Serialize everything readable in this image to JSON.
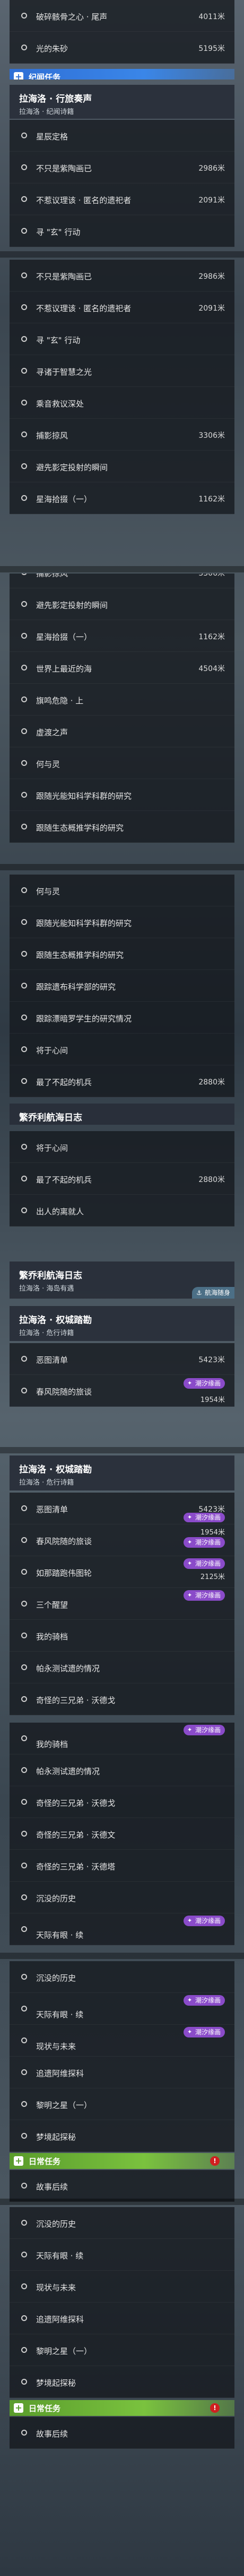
{
  "seg1_rows": [
    {
      "label": "破碎骸骨之心 · 尾声",
      "value": "4011米"
    },
    {
      "label": "光的朱砂",
      "value": "5195米"
    }
  ],
  "cat_mission": "纪闻任务",
  "header1": {
    "title": "拉海洛 · 行旅奏声",
    "subtitle": "拉海洛 · 纪闻诗籍"
  },
  "seg2_rows": [
    {
      "label": "星辰定格",
      "value": ""
    },
    {
      "label": "不只是紫陶画已",
      "value": "2986米"
    },
    {
      "label": "不惹议理该 · 匿名的遗祀者",
      "value": "2091米"
    },
    {
      "label": "寻 \"玄\" 行动",
      "value": ""
    }
  ],
  "seg3_rows": [
    {
      "label": "不只是紫陶画已",
      "value": "2986米"
    },
    {
      "label": "不惹议理该 · 匿名的遗祀者",
      "value": "2091米"
    },
    {
      "label": "寻 \"玄\" 行动",
      "value": ""
    },
    {
      "label": "寻诸于智慧之光",
      "value": ""
    },
    {
      "label": "乘音救议深处",
      "value": ""
    },
    {
      "label": "捕影掠风",
      "value": "3306米"
    },
    {
      "label": "避先影定投射的瞬间",
      "value": ""
    },
    {
      "label": "星海拾掇（一）",
      "value": "1162米"
    }
  ],
  "seg4_rows": [
    {
      "label": "捕影掠风",
      "value": "3306米"
    },
    {
      "label": "避先影定投射的瞬间",
      "value": ""
    },
    {
      "label": "星海拾掇（一）",
      "value": "1162米"
    },
    {
      "label": "世界上最近的海",
      "value": "4504米"
    },
    {
      "label": "旗鸣危隐 · 上",
      "value": ""
    },
    {
      "label": "虚渡之声",
      "value": ""
    },
    {
      "label": "何与灵",
      "value": ""
    },
    {
      "label": "跟随光能知科学科群的研究",
      "value": ""
    },
    {
      "label": "跟随生态概推学科的研究",
      "value": ""
    }
  ],
  "seg5_rows": [
    {
      "label": "何与灵",
      "value": ""
    },
    {
      "label": "跟随光能知科学科群的研究",
      "value": ""
    },
    {
      "label": "跟随生态概推学科的研究",
      "value": ""
    },
    {
      "label": "跟踪遗布科学部的研究",
      "value": ""
    },
    {
      "label": "跟踪漂暗罗学生的研究情况",
      "value": ""
    },
    {
      "label": "将于心间",
      "value": ""
    },
    {
      "label": "最了不起的机兵",
      "value": "2880米"
    }
  ],
  "header_log": "繁乔利航海日志",
  "seg6_rows": [
    {
      "label": "将于心间",
      "value": ""
    },
    {
      "label": "最了不起的机兵",
      "value": "2880米"
    },
    {
      "label": "出人的离就人",
      "value": ""
    }
  ],
  "header2": {
    "title": "繁乔利航海日志",
    "subtitle": "拉海洛 · 海岛有遇",
    "tag": "航海随身"
  },
  "header3": {
    "title": "拉海洛 · 权城踏勘",
    "subtitle": "拉海洛 · 危行诗籍"
  },
  "seg7_rows": [
    {
      "label": "恶图清单",
      "value": "5423米",
      "badge": "",
      "value2": ""
    },
    {
      "label": "春风院随的旅谈",
      "value": "",
      "badge": "潮汐缘画",
      "value2": "1954米"
    }
  ],
  "header4": {
    "title": "拉海洛 · 权城踏勘",
    "subtitle": "拉海洛 · 危行诗籍"
  },
  "seg8_rows": [
    {
      "label": "恶图清单",
      "value": "5423米",
      "badge": "潮汐缘画",
      "value2": ""
    },
    {
      "label": "春风院随的旅谈",
      "value": "",
      "badge": "潮汐缘画",
      "value2": "1954米"
    },
    {
      "label": "如那踏跑伟图轮",
      "value": "",
      "badge": "潮汐缘画",
      "value2": "2125米"
    },
    {
      "label": "三个醒望",
      "value": "",
      "badge": "潮汐缘画",
      "value2": ""
    },
    {
      "label": "我的骑档",
      "value": "",
      "badge": "",
      "value2": ""
    },
    {
      "label": "帕永测试遗的情况",
      "value": "",
      "badge": "",
      "value2": ""
    },
    {
      "label": "奇怪的三兄弟 · 沃德戈",
      "value": "",
      "badge": "",
      "value2": ""
    }
  ],
  "seg9_rows": [
    {
      "label": "我的骑档",
      "value": "",
      "badge": "潮汐缘画"
    },
    {
      "label": "帕永测试遗的情况",
      "value": "",
      "badge": ""
    },
    {
      "label": "奇怪的三兄弟 · 沃德戈",
      "value": "",
      "badge": ""
    },
    {
      "label": "奇怪的三兄弟 · 沃德文",
      "value": "",
      "badge": ""
    },
    {
      "label": "奇怪的三兄弟 · 沃德塔",
      "value": "",
      "badge": ""
    },
    {
      "label": "沉没的历史",
      "value": "",
      "badge": ""
    },
    {
      "label": "天际有眼 · 续",
      "value": "",
      "badge": "潮汐缘画"
    }
  ],
  "seg10_rows": [
    {
      "label": "沉没的历史",
      "value": "",
      "badge": ""
    },
    {
      "label": "天际有眼 · 续",
      "value": "",
      "badge": "潮汐缘画"
    },
    {
      "label": "现状与未来",
      "value": "",
      "badge": "潮汐缘画"
    },
    {
      "label": "追遗阿维探科",
      "value": "",
      "badge": ""
    },
    {
      "label": "黎明之星（一）",
      "value": "",
      "badge": ""
    },
    {
      "label": "梦境起探秘",
      "value": "",
      "badge": ""
    }
  ],
  "cat_daily": "日常任务",
  "seg11_rows": [
    {
      "label": "故事后续",
      "value": ""
    }
  ],
  "seg12_rows": [
    {
      "label": "沉没的历史",
      "value": ""
    },
    {
      "label": "天际有眼 · 续",
      "value": ""
    },
    {
      "label": "现状与未来",
      "value": ""
    },
    {
      "label": "追遗阿维探科",
      "value": ""
    },
    {
      "label": "黎明之星（一）",
      "value": ""
    },
    {
      "label": "梦境起探秘",
      "value": ""
    }
  ],
  "seg13_rows": [
    {
      "label": "故事后续",
      "value": ""
    }
  ],
  "colors": {
    "accent_blue": "#2f6fd6",
    "accent_green": "#5a9c2c",
    "badge_purple": "#8a4bc9",
    "alert_red": "#d02020"
  }
}
